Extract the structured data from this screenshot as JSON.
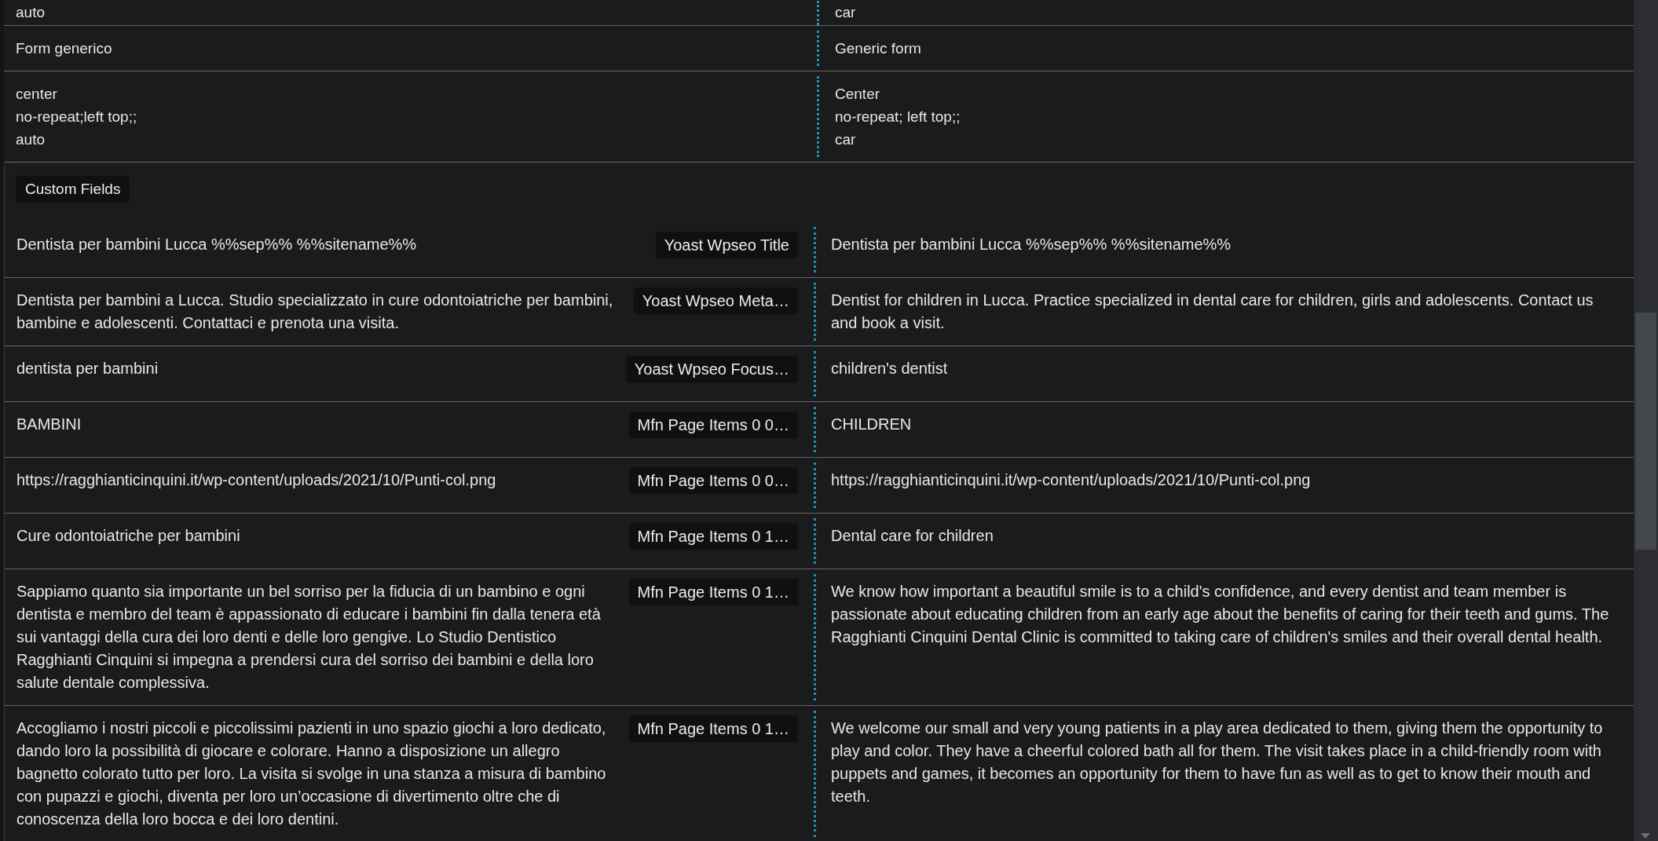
{
  "rows_above": [
    {
      "source": "auto",
      "translation": "car",
      "cut_top": true
    },
    {
      "source": "Form generico",
      "translation": "Generic form",
      "cut_top": false
    },
    {
      "source": "center\nno-repeat;left top;;\nauto",
      "translation": "Center\nno-repeat; left top;;\ncar",
      "cut_top": false
    }
  ],
  "custom_fields": {
    "heading": "Custom Fields",
    "rows": [
      {
        "source": "Dentista per bambini Lucca %%sep%% %%sitename%%",
        "field": "Yoast Wpseo Title",
        "translation": "Dentista per bambini Lucca %%sep%% %%sitename%%"
      },
      {
        "source": "Dentista per bambini a Lucca. Studio specializzato in cure odontoiatriche per bambini, bambine e adolescenti. Contattaci e prenota una visita.",
        "field": "Yoast Wpseo Meta…",
        "translation": "Dentist for children in Lucca. Practice specialized in dental care for children, girls and adolescents. Contact us and book a visit."
      },
      {
        "source": "dentista per bambini",
        "field": "Yoast Wpseo Focus…",
        "translation": "children's dentist"
      },
      {
        "source": "BAMBINI",
        "field": "Mfn Page Items 0 0…",
        "translation": "CHILDREN"
      },
      {
        "source": "https://ragghianticinquini.it/wp-content/uploads/2021/10/Punti-col.png",
        "field": "Mfn Page Items 0 0…",
        "translation": "https://ragghianticinquini.it/wp-content/uploads/2021/10/Punti-col.png"
      },
      {
        "source": "Cure odontoiatriche per bambini",
        "field": "Mfn Page Items 0 1…",
        "translation": "Dental care for children"
      },
      {
        "source": "Sappiamo quanto sia importante un bel sorriso per la fiducia di un bambino e ogni dentista e membro del team è appassionato di educare i bambini fin dalla tenera età sui vantaggi della cura dei loro denti e delle loro gengive. Lo Studio Dentistico Ragghianti Cinquini si impegna a prendersi cura del sorriso dei bambini e della loro salute dentale complessiva.",
        "field": "Mfn Page Items 0 1…",
        "translation": "We know how important a beautiful smile is to a child's confidence, and every dentist and team member is passionate about educating children from an early age about the benefits of caring for their teeth and gums. The Ragghianti Cinquini Dental Clinic is committed to taking care of children's smiles and their overall dental health."
      },
      {
        "source": "Accogliamo i nostri piccoli e piccolissimi pazienti in uno spazio giochi a loro dedicato, dando loro la possibilità di giocare e colorare. Hanno a disposizione un allegro bagnetto colorato tutto per loro. La visita si svolge in una stanza a misura di bambino con pupazzi e giochi, diventa per loro un’occasione di divertimento oltre che di conoscenza della loro bocca e dei loro dentini.",
        "field": "Mfn Page Items 0 1…",
        "translation": "We welcome our small and very young patients in a play area dedicated to them, giving them the opportunity to play and color. They have a cheerful colored bath all for them. The visit takes place in a child-friendly room with puppets and games, it becomes an opportunity for them to have fun as well as to get to know their mouth and teeth."
      }
    ]
  }
}
